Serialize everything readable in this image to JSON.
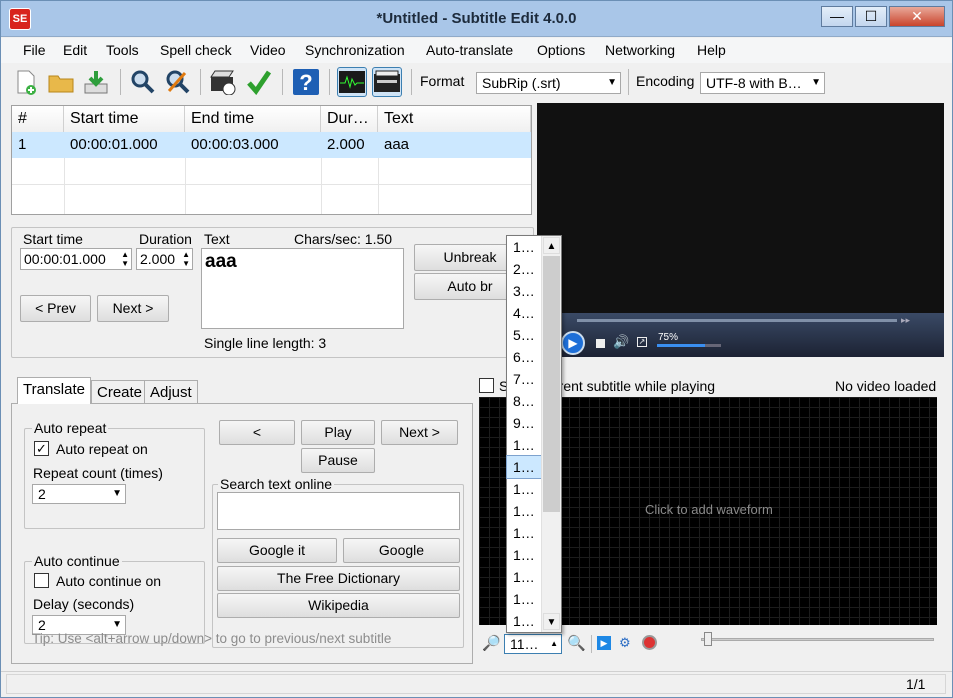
{
  "window": {
    "title": "*Untitled - Subtitle Edit 4.0.0",
    "app_icon": "SE",
    "min": "—",
    "max": "☐",
    "close": "✕"
  },
  "menu": [
    "File",
    "Edit",
    "Tools",
    "Spell check",
    "Video",
    "Synchronization",
    "Auto-translate",
    "Options",
    "Networking",
    "Help"
  ],
  "toolbar": {
    "format_label": "Format",
    "format_value": "SubRip (.srt)",
    "encoding_label": "Encoding",
    "encoding_value": "UTF-8 with B…"
  },
  "grid": {
    "headers": [
      "#",
      "Start time",
      "End time",
      "Dur…",
      "Text"
    ],
    "rows": [
      [
        "1",
        "00:00:01.000",
        "00:00:03.000",
        "2.000",
        "aaa"
      ]
    ]
  },
  "editor": {
    "start_label": "Start time",
    "start_value": "00:00:01.000",
    "duration_label": "Duration",
    "duration_value": "2.000",
    "text_label": "Text",
    "chars_sec": "Chars/sec: 1.50",
    "text_value": "aaa",
    "unbreak": "Unbreak",
    "auto_br": "Auto br",
    "prev": "< Prev",
    "next": "Next >",
    "line_length": "Single line length: 3"
  },
  "tabs": [
    "Translate",
    "Create",
    "Adjust"
  ],
  "translate": {
    "auto_repeat_title": "Auto repeat",
    "auto_repeat_on": "Auto repeat on",
    "repeat_count_label": "Repeat count (times)",
    "repeat_count": "2",
    "auto_continue_title": "Auto continue",
    "auto_continue_on": "Auto continue on",
    "delay_label": "Delay (seconds)",
    "delay": "2",
    "btn_prev": "<",
    "btn_play": "Play",
    "btn_next": "Next >",
    "btn_pause": "Pause",
    "search_title": "Search text online",
    "google_it": "Google it",
    "google": "Google",
    "free_dict": "The Free Dictionary",
    "wikipedia": "Wikipedia",
    "tip": "Tip: Use <alt+arrow up/down> to go to previous/next subtitle"
  },
  "video": {
    "volume": "75%",
    "s_prefix": "S",
    "follow_label": "rrent subtitle while playing",
    "no_video": "No video loaded",
    "waveform_hint": "Click to add waveform",
    "zoom_value": "11…"
  },
  "dropdown": {
    "items": [
      "1…",
      "2…",
      "3…",
      "4…",
      "5…",
      "6…",
      "7…",
      "8…",
      "9…",
      "1…",
      "1…",
      "1…",
      "1…",
      "1…",
      "1…",
      "1…",
      "1…",
      "1…"
    ],
    "selected_index": 10
  },
  "status": {
    "page": "1/1"
  },
  "colors": {
    "selected_row": "#cce8ff",
    "video_bg": "#111111",
    "waveform_bg": "#000000",
    "title_bar": "#a9c6e8"
  }
}
